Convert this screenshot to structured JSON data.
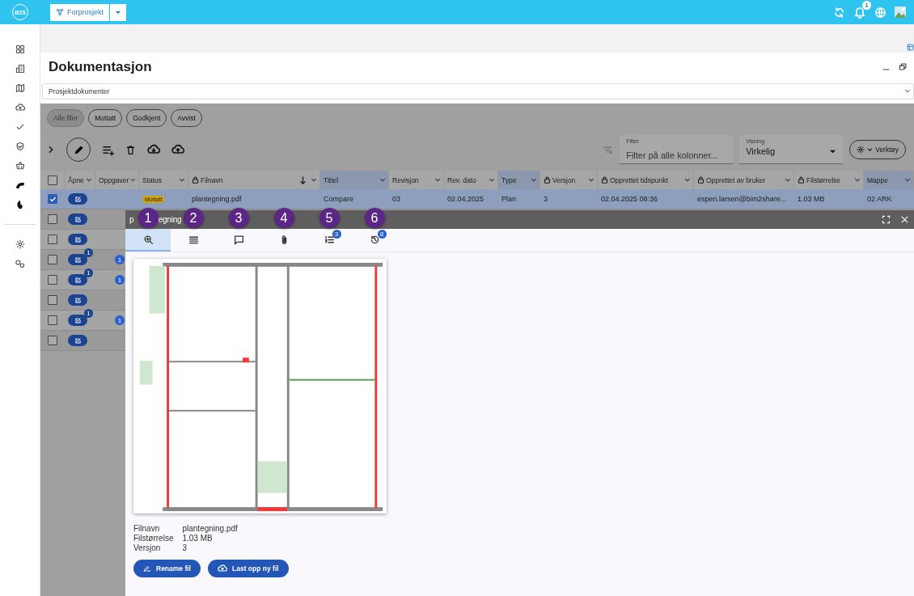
{
  "app": {
    "logo": "B2S",
    "project": "Forprosjekt",
    "notification_count": "1"
  },
  "page": {
    "title": "Dokumentasjon",
    "category": "Prosjektdokumenter"
  },
  "filter_chips": [
    {
      "label": "Alle filer",
      "selected": true
    },
    {
      "label": "Mottatt",
      "selected": false
    },
    {
      "label": "Godkjent",
      "selected": false
    },
    {
      "label": "Avvist",
      "selected": false
    }
  ],
  "toolbar": {
    "filter": {
      "label": "Filter",
      "placeholder": "Filter på alle kolonner..."
    },
    "view": {
      "label": "Visning",
      "value": "Virkelig"
    },
    "tools": "Verktøy"
  },
  "table": {
    "all_checked": false,
    "columns": [
      {
        "label": "Åpne",
        "locked": false,
        "highlighted": false
      },
      {
        "label": "Oppgaver",
        "locked": false,
        "highlighted": false
      },
      {
        "label": "Status",
        "locked": false,
        "highlighted": false
      },
      {
        "label": "Filnavn",
        "locked": true,
        "highlighted": false,
        "sorted": true
      },
      {
        "label": "Tittel",
        "locked": false,
        "highlighted": true
      },
      {
        "label": "Revisjon",
        "locked": false,
        "highlighted": false
      },
      {
        "label": "Rev. dato",
        "locked": false,
        "highlighted": false
      },
      {
        "label": "Type",
        "locked": false,
        "highlighted": true
      },
      {
        "label": "Versjon",
        "locked": true,
        "highlighted": false
      },
      {
        "label": "Opprettet tidspunkt",
        "locked": true,
        "highlighted": false
      },
      {
        "label": "Opprettet av bruker",
        "locked": true,
        "highlighted": false
      },
      {
        "label": "Filstørrelse",
        "locked": true,
        "highlighted": false
      },
      {
        "label": "Mappe",
        "locked": false,
        "highlighted": true
      }
    ],
    "rows": [
      {
        "checked": true,
        "selected": true,
        "status": "Mottatt",
        "cells": [
          "plantegning.pdf",
          "Compare",
          "03",
          "02.04.2025",
          "Plan",
          "3",
          "02.04.2025 08:36",
          "espen.larsen@bim2share...",
          "1.03 MB",
          "02 ARK"
        ]
      },
      {
        "checked": false,
        "selected": false
      },
      {
        "checked": false,
        "selected": false
      },
      {
        "checked": false,
        "selected": false,
        "open_badge": "1",
        "tasks": "1"
      },
      {
        "checked": false,
        "selected": false,
        "open_badge": "1",
        "tasks": "1"
      },
      {
        "checked": false,
        "selected": false
      },
      {
        "checked": false,
        "selected": false,
        "open_badge": "1",
        "tasks": "1"
      },
      {
        "checked": false,
        "selected": false
      }
    ]
  },
  "panel": {
    "title_parts": [
      "p",
      "egning"
    ],
    "tabs": [
      {
        "kind": "preview",
        "selected": true
      },
      {
        "kind": "details",
        "selected": false
      },
      {
        "kind": "comments",
        "selected": false
      },
      {
        "kind": "attachments",
        "selected": false
      },
      {
        "kind": "tasks",
        "selected": false,
        "badge": "3"
      },
      {
        "kind": "history",
        "selected": false,
        "badge": "8"
      }
    ],
    "callouts": [
      "1",
      "2",
      "3",
      "4",
      "5",
      "6"
    ],
    "preview": {
      "kind": "picture"
    },
    "file_info": [
      {
        "label": "Filnavn",
        "value": "plantegning.pdf"
      },
      {
        "label": "Filstørrelse",
        "value": "1.03 MB"
      },
      {
        "label": "Versjon",
        "value": "3"
      }
    ],
    "buttons": [
      {
        "kind": "rename",
        "label": "Rename fil"
      },
      {
        "kind": "upload",
        "label": "Last opp ny fil"
      }
    ]
  }
}
